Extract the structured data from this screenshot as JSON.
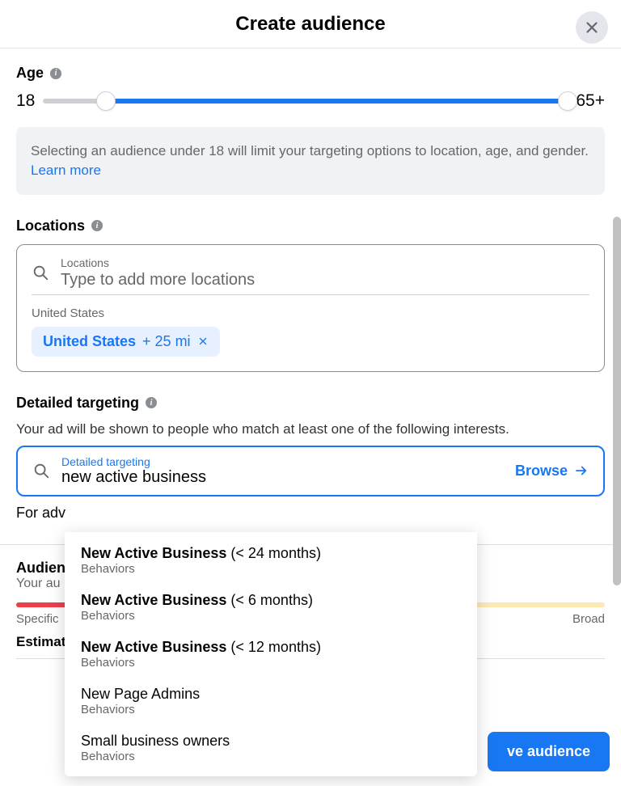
{
  "header": {
    "title": "Create audience"
  },
  "age": {
    "label": "Age",
    "min": "18",
    "max": "65+"
  },
  "notice": {
    "text": "Selecting an audience under 18 will limit your targeting options to location, age, and gender. ",
    "link": "Learn more"
  },
  "locations": {
    "label": "Locations",
    "float_label": "Locations",
    "placeholder": "Type to add more locations",
    "region_label": "United States",
    "chip": {
      "name": "United States",
      "radius": "+ 25 mi"
    }
  },
  "detailed": {
    "label": "Detailed targeting",
    "subtitle": "Your ad will be shown to people who match at least one of the following interests.",
    "float_label": "Detailed targeting",
    "value": "new active business",
    "browse": "Browse",
    "advanced_prefix": "For adv"
  },
  "dropdown": [
    {
      "bold": "New Active Business",
      "rest": " (< 24 months)",
      "category": "Behaviors"
    },
    {
      "bold": "New Active Business",
      "rest": " (< 6 months)",
      "category": "Behaviors"
    },
    {
      "bold": "New Active Business",
      "rest": " (< 12 months)",
      "category": "Behaviors"
    },
    {
      "bold": "",
      "rest": "New Page Admins",
      "category": "Behaviors"
    },
    {
      "bold": "",
      "rest": "Small business owners",
      "category": "Behaviors"
    }
  ],
  "audience_def": {
    "title": "Audien",
    "subtitle": "Your au",
    "specific": "Specific",
    "broad": "Broad",
    "estimated": "Estimat"
  },
  "footer": {
    "save": "ve audience"
  }
}
